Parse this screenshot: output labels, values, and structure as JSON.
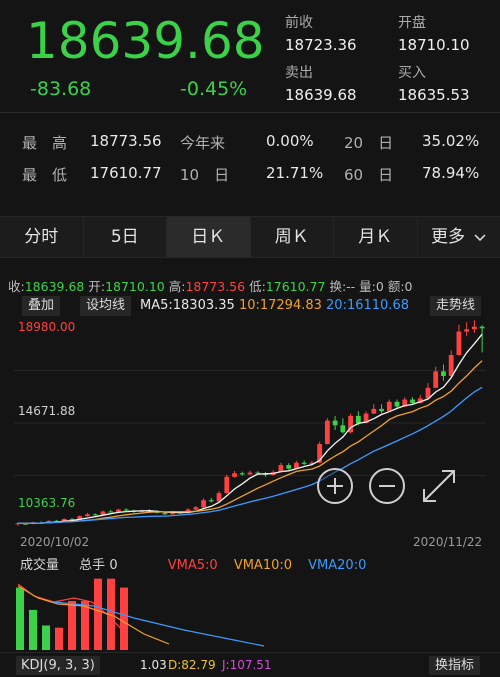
{
  "quote": {
    "price": "18639.68",
    "change": "-83.68",
    "change_pct": "-0.45%",
    "prev_close_label": "前收",
    "prev_close": "18723.36",
    "open_label": "开盘",
    "open": "18710.10",
    "ask_label": "卖出",
    "ask": "18639.68",
    "bid_label": "买入",
    "bid": "18635.53"
  },
  "stats": {
    "high_label": "最　高",
    "high": "18773.56",
    "low_label": "最　低",
    "low": "17610.77",
    "ytd_label": "今年来",
    "ytd": "0.00%",
    "d10_label": "10　日",
    "d10": "21.71%",
    "d20_label": "20　日",
    "d20": "35.02%",
    "d60_label": "60　日",
    "d60": "78.94%"
  },
  "tabs": [
    "分时",
    "5日",
    "日Ｋ",
    "周Ｋ",
    "月Ｋ",
    "更多"
  ],
  "ohlc": {
    "close_label": "收:",
    "close": "18639.68",
    "open_label": "开:",
    "open": "18710.10",
    "high_label": "高:",
    "high": "18773.56",
    "low_label": "低:",
    "low": "17610.77",
    "turnover_label": "换:",
    "turnover": "--",
    "volume_label": "量:",
    "volume": "0",
    "amount_label": "额:",
    "amount": "0"
  },
  "ma_bar": {
    "overlay_btn": "叠加",
    "settings_btn": "设均线",
    "ma5_label": "MA5:",
    "ma5": "18303.35",
    "ma10_label": "10:",
    "ma10": "17294.83",
    "ma20_label": "20:",
    "ma20": "16110.68",
    "trend_btn": "走势线"
  },
  "y_labels": {
    "top": "18980.00",
    "mid": "14671.88",
    "bottom": "10363.76"
  },
  "x_labels": {
    "start": "2020/10/02",
    "end": "2020/11/22"
  },
  "volume": {
    "title": "成交量",
    "total_label": "总手",
    "total": "0",
    "vma5": "VMA5:0",
    "vma10": "VMA10:0",
    "vma20": "VMA20:0"
  },
  "kdj": {
    "tag": "KDJ(9, 3, 3)",
    "k": "1.03",
    "d": "D:82.79",
    "j": "J:107.51",
    "switch_btn": "换指标"
  },
  "colors": {
    "up": "#ff4141",
    "down": "#3bd24a",
    "ma5": "#f5f5f5",
    "ma10": "#f0a12b",
    "ma20": "#3b9bff"
  },
  "chart_data": {
    "type": "candlestick",
    "x_start": "2020/10/02",
    "x_end": "2020/11/22",
    "ylim": [
      10363.76,
      18980.0
    ],
    "candles": [
      [
        10280,
        10320,
        10200,
        10340
      ],
      [
        10300,
        10290,
        10250,
        10350
      ],
      [
        10290,
        10360,
        10270,
        10380
      ],
      [
        10350,
        10330,
        10300,
        10400
      ],
      [
        10330,
        10420,
        10310,
        10440
      ],
      [
        10420,
        10400,
        10380,
        10460
      ],
      [
        10400,
        10500,
        10390,
        10520
      ],
      [
        10500,
        10480,
        10450,
        10540
      ],
      [
        10480,
        10620,
        10460,
        10650
      ],
      [
        10620,
        10700,
        10600,
        10760
      ],
      [
        10700,
        10680,
        10640,
        10740
      ],
      [
        10680,
        10820,
        10660,
        10860
      ],
      [
        10820,
        10800,
        10780,
        10880
      ],
      [
        10800,
        10900,
        10780,
        10940
      ],
      [
        10900,
        10860,
        10840,
        10960
      ],
      [
        10860,
        10800,
        10760,
        10900
      ],
      [
        10800,
        10860,
        10780,
        10900
      ],
      [
        10860,
        10840,
        10800,
        10920
      ],
      [
        10840,
        10760,
        10740,
        10880
      ],
      [
        10760,
        10700,
        10680,
        10800
      ],
      [
        10700,
        10780,
        10680,
        10820
      ],
      [
        10780,
        10760,
        10720,
        10840
      ],
      [
        10760,
        10900,
        10740,
        10960
      ],
      [
        10900,
        11000,
        10880,
        11060
      ],
      [
        11000,
        11300,
        10980,
        11380
      ],
      [
        11300,
        11250,
        11200,
        11400
      ],
      [
        11250,
        11600,
        11220,
        11700
      ],
      [
        11600,
        12300,
        11580,
        12400
      ],
      [
        12300,
        12450,
        12260,
        12550
      ],
      [
        12450,
        12400,
        12350,
        12520
      ],
      [
        12400,
        12480,
        12380,
        12560
      ],
      [
        12480,
        12440,
        12400,
        12540
      ],
      [
        12440,
        12380,
        12300,
        12500
      ],
      [
        12380,
        12500,
        12360,
        12580
      ],
      [
        12500,
        12800,
        12480,
        12900
      ],
      [
        12800,
        12650,
        12600,
        12880
      ],
      [
        12650,
        12900,
        12620,
        12980
      ],
      [
        12900,
        12850,
        12800,
        13000
      ],
      [
        12850,
        12900,
        12820,
        12980
      ],
      [
        12900,
        13700,
        12880,
        13800
      ],
      [
        13700,
        14700,
        13680,
        14800
      ],
      [
        14700,
        14500,
        14300,
        14900
      ],
      [
        14500,
        14200,
        14150,
        14800
      ],
      [
        14200,
        14900,
        14150,
        15000
      ],
      [
        14900,
        14600,
        14500,
        15100
      ],
      [
        14600,
        15000,
        14580,
        15100
      ],
      [
        15000,
        15200,
        14980,
        15400
      ],
      [
        15200,
        15100,
        15000,
        15400
      ],
      [
        15100,
        15500,
        15080,
        15600
      ],
      [
        15500,
        15300,
        15250,
        15600
      ],
      [
        15300,
        15600,
        15280,
        15700
      ],
      [
        15600,
        15450,
        15400,
        15700
      ],
      [
        15450,
        15650,
        15430,
        15800
      ],
      [
        15650,
        16100,
        15630,
        16300
      ],
      [
        16100,
        16800,
        16080,
        17000
      ],
      [
        16800,
        16600,
        16400,
        17100
      ],
      [
        16600,
        17500,
        16580,
        17700
      ],
      [
        17500,
        18500,
        17480,
        18800
      ],
      [
        18500,
        18600,
        18300,
        18900
      ],
      [
        18600,
        18710,
        18450,
        18980
      ],
      [
        18710,
        18640,
        17610,
        18773
      ]
    ],
    "volumes": [
      560,
      360,
      220,
      200,
      440,
      440,
      640,
      640,
      560
    ]
  }
}
